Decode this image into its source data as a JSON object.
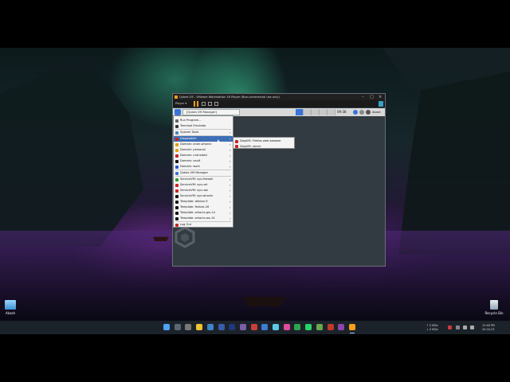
{
  "desktop": {
    "icons": [
      {
        "label": "Akash"
      },
      {
        "label": "Recycle Bin"
      }
    ]
  },
  "vmware": {
    "window_title": "Qubes OS - VMware Workstation 16 Player (Non-commercial use only)",
    "toolbar": {
      "player_label": "Player ▾"
    },
    "accent": "#f6a01a"
  },
  "qubes_panel": {
    "task_label": "[Qubes VM Manager]",
    "clock": "09:38",
    "user": "Akash",
    "accent": "#3874d8"
  },
  "app_menu": {
    "items": [
      {
        "label": "Run Program...",
        "icon": "run-icon",
        "color": "#666666",
        "has_submenu": false
      },
      {
        "label": "Terminal Emulator",
        "icon": "terminal-icon",
        "color": "#333333",
        "has_submenu": false
      },
      {
        "label": "System Tools",
        "icon": "system-tools-icon",
        "color": "#4a7fbf",
        "has_submenu": true
      },
      {
        "label": "Disposable:",
        "icon": "disposable-icon",
        "color": "#cc2222",
        "has_submenu": true,
        "highlighted": true
      },
      {
        "label": "Domain: anon-whonix",
        "icon": "domain-icon",
        "color": "#e0a000",
        "has_submenu": true
      },
      {
        "label": "Domain: personal",
        "icon": "domain-icon",
        "color": "#e0a000",
        "has_submenu": true
      },
      {
        "label": "Domain: untrusted",
        "icon": "domain-icon",
        "color": "#cc2222",
        "has_submenu": true
      },
      {
        "label": "Domain: vault",
        "icon": "domain-icon",
        "color": "#111111",
        "has_submenu": true
      },
      {
        "label": "Domain: work",
        "icon": "domain-icon",
        "color": "#2255cc",
        "has_submenu": true
      },
      {
        "label": "Qubes VM Manager",
        "icon": "qubes-manager-icon",
        "color": "#3874d8",
        "has_submenu": false
      },
      {
        "label": "ServiceVM: sys-firewall",
        "icon": "service-icon",
        "color": "#2a9d2a",
        "has_submenu": true
      },
      {
        "label": "ServiceVM: sys-net",
        "icon": "service-icon",
        "color": "#cc2222",
        "has_submenu": true
      },
      {
        "label": "ServiceVM: sys-usb",
        "icon": "service-icon",
        "color": "#cc2222",
        "has_submenu": true
      },
      {
        "label": "ServiceVM: sys-whonix",
        "icon": "service-icon",
        "color": "#111111",
        "has_submenu": true
      },
      {
        "label": "Template: debian-9",
        "icon": "template-icon",
        "color": "#111111",
        "has_submenu": true
      },
      {
        "label": "Template: fedora-26",
        "icon": "template-icon",
        "color": "#111111",
        "has_submenu": true
      },
      {
        "label": "Template: whonix-gw-14",
        "icon": "template-icon",
        "color": "#111111",
        "has_submenu": true
      },
      {
        "label": "Template: whonix-ws-14",
        "icon": "template-icon",
        "color": "#111111",
        "has_submenu": true
      }
    ],
    "logout": {
      "label": "Log Out",
      "icon": "logout-icon",
      "color": "#cc2222"
    },
    "highlight_color": "#3e6fb5"
  },
  "submenu": {
    "items": [
      {
        "label": "DispVM: Firefox web browser",
        "icon": "firefox-icon",
        "color": "#cc2222"
      },
      {
        "label": "DispVM: xterm",
        "icon": "xterm-icon",
        "color": "#cc2222"
      }
    ]
  },
  "taskbar": {
    "net_up": "↑ 0 KB/s",
    "net_down": "↓ 0 KB/s",
    "time": "12:48 PM",
    "date": "20-04-23",
    "app_icon_colors": [
      "#4da3ff",
      "#5a6675",
      "#777777",
      "#f1c232",
      "#3d85c6",
      "#3a5ba8",
      "#1f3a7a",
      "#7b5ea7",
      "#c73e3e",
      "#3e7cd1",
      "#5bc8e8",
      "#e04b9a",
      "#2ea44f",
      "#25d366",
      "#6aa84f",
      "#c0392b",
      "#8e44ad",
      "#f6a01a"
    ]
  }
}
